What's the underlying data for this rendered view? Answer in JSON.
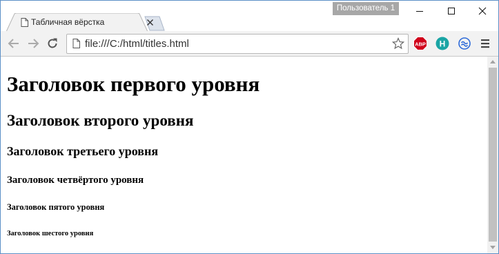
{
  "window": {
    "profile_label": "Пользователь 1",
    "controls": [
      "minimize",
      "maximize",
      "close"
    ]
  },
  "tab": {
    "title": "Табличная вёрстка",
    "icon": "page-icon",
    "close_icon": "close-icon"
  },
  "toolbar": {
    "back_icon": "back-arrow-icon",
    "forward_icon": "forward-arrow-icon",
    "reload_icon": "reload-icon",
    "url": "file:///C:/html/titles.html",
    "bookmark_icon": "star-icon",
    "extensions": [
      {
        "name": "adblock-plus-icon",
        "label": "ABP",
        "color": "#d0021b"
      },
      {
        "name": "extension-h-icon",
        "label": "H",
        "color": "#1aa5a5"
      },
      {
        "name": "extension-sync-icon",
        "label": "",
        "color": "#2e6bd9"
      }
    ],
    "menu_icon": "menu-icon"
  },
  "page": {
    "h1": "Заголовок первого уровня",
    "h2": "Заголовок второго уровня",
    "h3": "Заголовок третьего уровня",
    "h4": "Заголовок четвёртого уровня",
    "h5": "Заголовок пятого уровня",
    "h6": "Заголовок шестого уровня"
  }
}
